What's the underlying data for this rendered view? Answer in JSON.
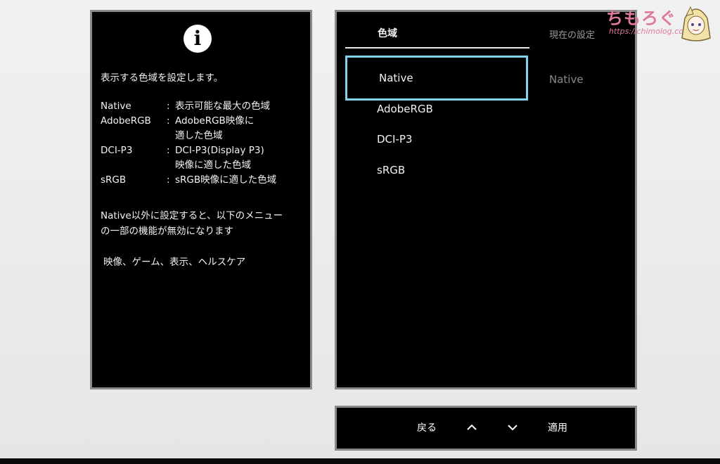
{
  "info": {
    "intro": "表示する色域を設定します。",
    "items": [
      {
        "name": "Native",
        "sep": ":",
        "desc": [
          "表示可能な最大の色域"
        ]
      },
      {
        "name": "AdobeRGB",
        "sep": ":",
        "desc": [
          "AdobeRGB映像に",
          "適した色域"
        ]
      },
      {
        "name": "DCI-P3",
        "sep": ":",
        "desc": [
          "DCI-P3(Display P3)",
          "映像に適した色域"
        ]
      },
      {
        "name": "sRGB",
        "sep": ":",
        "desc": [
          "sRGB映像に適した色域"
        ]
      }
    ],
    "note_line1": "Native以外に設定すると、以下のメニュー",
    "note_line2": "の一部の機能が無効になります",
    "affected": "映像、ゲーム、表示、ヘルスケア"
  },
  "menu": {
    "tab_label": "色域",
    "current_header": "現在の設定",
    "options": [
      "Native",
      "AdobeRGB",
      "DCI-P3",
      "sRGB"
    ],
    "selected": "Native",
    "current_value": "Native"
  },
  "nav": {
    "back_label": "戻る",
    "up_icon": "chevron-up-icon",
    "down_icon": "chevron-down-icon",
    "apply_label": "適用"
  },
  "watermark": {
    "title": "ちもろぐ",
    "url": "https://chimolog.co/"
  },
  "colors": {
    "selection_border": "#7fd3ec",
    "panel_bg": "#000000",
    "panel_border": "#8a8a8a",
    "watermark": "#e07a9a"
  }
}
